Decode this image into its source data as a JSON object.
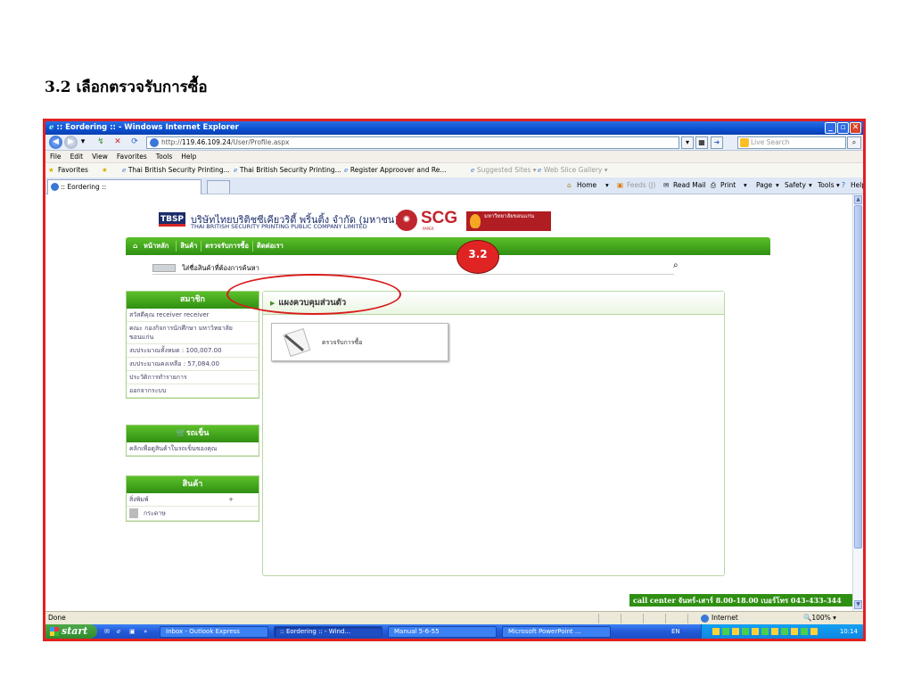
{
  "slide": {
    "heading": "3.2  เลือกตรวจรับการซื้อ"
  },
  "window": {
    "title": ":: Eordering :: - Windows Internet Explorer",
    "url_prefix": "http://",
    "url_host": "119.46.109.24",
    "url_path": "/User/Profile.aspx",
    "search_placeholder": "Live Search"
  },
  "menu": [
    "File",
    "Edit",
    "View",
    "Favorites",
    "Tools",
    "Help"
  ],
  "favorites": {
    "label": "Favorites",
    "links": [
      "Thai British Security Printing...",
      "Thai British Security Printing...",
      "Register Approover and Re...",
      "Suggested Sites ▾",
      "Web Slice Gallery ▾"
    ]
  },
  "tab": {
    "label": ":: Eordering ::"
  },
  "toolbar": {
    "home": "Home",
    "feeds": "Feeds (J)",
    "read_mail": "Read Mail",
    "print": "Print",
    "page": "Page",
    "safety": "Safety",
    "tools": "Tools",
    "help": "Help"
  },
  "site": {
    "company_th": "บริษัทไทยบริติชซีเคียวริตี้ พริ้นติ้ง จำกัด (มหาชน)",
    "company_en": "THAI BRITISH SECURITY PRINTING PUBLIC COMPANY LIMITED",
    "tbsp_logo": "TBSP",
    "scg_logo": "SCG",
    "scg_sub": "PAPER",
    "kku_logo": "มหาวิทยาลัยขอนแก่น",
    "nav": [
      "หน้าหลัก",
      "สินค้า",
      "ตรวจรับการซื้อ",
      "ติดต่อเรา"
    ],
    "search_label": "ใส่ชื่อสินค้าที่ต้องการค้นหา",
    "member": {
      "title": "สมาชิก",
      "items": [
        "สวัสดีคุณ receiver receiver",
        "คณะ กองกิจการนักศึกษา มหาวิทยาลัยขอนแก่น",
        "งบประมาณทั้งหมด : 100,007.00",
        "งบประมาณคงเหลือ : 57,084.00",
        "ประวัติการทำรายการ",
        "ออกจากระบบ"
      ]
    },
    "cart": {
      "title": "รถเข็น",
      "item": "คลิกเพื่อดูสินค้าในรถเข็นของคุณ"
    },
    "products": {
      "title": "สินค้า",
      "items": [
        "สิ่งพิมพ์",
        "กระดาษ"
      ],
      "expand": "+"
    },
    "panel": {
      "title": "แผงควบคุมส่วนตัว",
      "card": "ตรวจรับการซื้อ"
    },
    "annotation": "3.2",
    "call_center": "call center จันทร์-เสาร์ 8.00-18.00 เบอร์โทร 043-433-344"
  },
  "status": {
    "text": "Done",
    "zone": "Internet",
    "zoom": "100%"
  },
  "taskbar": {
    "start": "start",
    "tasks": [
      "Inbox - Outlook Express",
      ":: Eordering :: - Wind...",
      "Manual 5-6-55",
      "Microsoft PowerPoint ..."
    ],
    "lang": "EN",
    "clock": "10:14"
  }
}
